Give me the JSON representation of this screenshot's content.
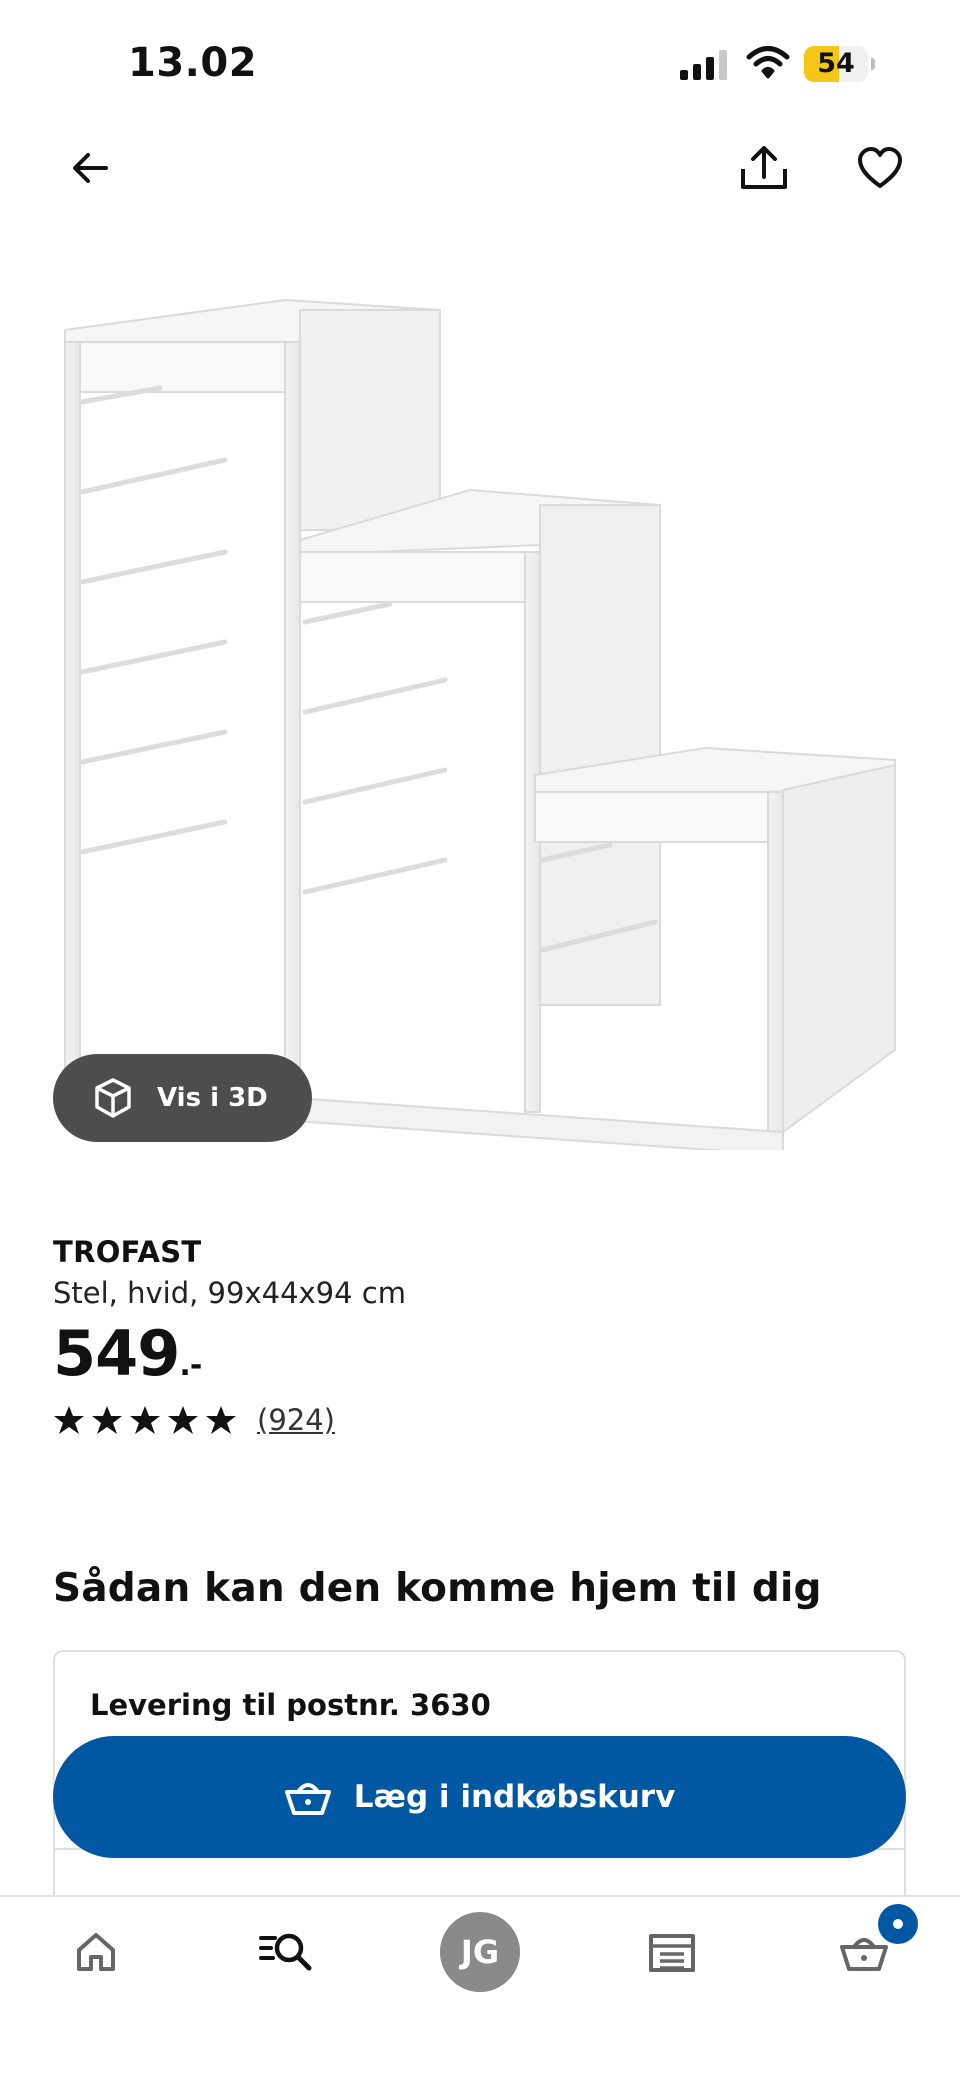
{
  "status_bar": {
    "time": "13.02",
    "battery_level": "54",
    "battery_fraction": 0.54,
    "battery_color": "#f5c518"
  },
  "top_nav": {
    "back_icon": "arrow-left-icon",
    "share_icon": "share-icon",
    "favorite_icon": "heart-icon"
  },
  "product": {
    "view_3d_label": "Vis i 3D",
    "name": "TROFAST",
    "description": "Stel, hvid, 99x44x94 cm",
    "price": "549",
    "price_suffix": ".-",
    "rating_stars": 5,
    "rating_count": "(924)"
  },
  "delivery": {
    "heading": "Sådan kan den komme hjem til dig",
    "card_title": "Levering til postnr. 3630"
  },
  "cta": {
    "add_to_cart_label": "Læg i indkøbskurv",
    "color": "#0058a3"
  },
  "bottom_nav": {
    "items": [
      "home-icon",
      "search-icon",
      "profile-avatar",
      "store-icon",
      "basket-icon"
    ],
    "profile_initials": "JG",
    "cart_badge_color": "#0058a3"
  }
}
